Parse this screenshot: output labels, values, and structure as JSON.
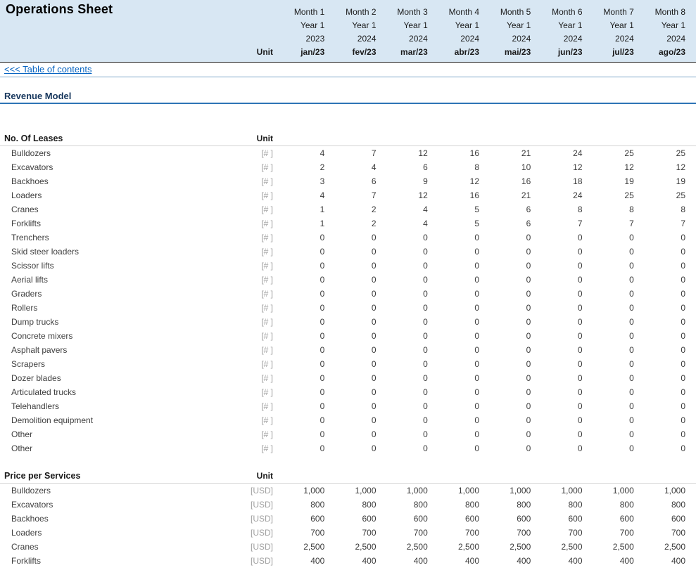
{
  "header": {
    "title": "Operations Sheet",
    "unit_label": "Unit",
    "columns": [
      {
        "month": "Month 1",
        "year": "Year 1",
        "cal_year": "2023",
        "date": "jan/23"
      },
      {
        "month": "Month 2",
        "year": "Year 1",
        "cal_year": "2024",
        "date": "fev/23"
      },
      {
        "month": "Month 3",
        "year": "Year 1",
        "cal_year": "2024",
        "date": "mar/23"
      },
      {
        "month": "Month 4",
        "year": "Year 1",
        "cal_year": "2024",
        "date": "abr/23"
      },
      {
        "month": "Month 5",
        "year": "Year 1",
        "cal_year": "2024",
        "date": "mai/23"
      },
      {
        "month": "Month 6",
        "year": "Year 1",
        "cal_year": "2024",
        "date": "jun/23"
      },
      {
        "month": "Month 7",
        "year": "Year 1",
        "cal_year": "2024",
        "date": "jul/23"
      },
      {
        "month": "Month 8",
        "year": "Year 1",
        "cal_year": "2024",
        "date": "ago/23"
      }
    ]
  },
  "toc_link": "<<< Table of contents",
  "revenue_section_title": "Revenue Model",
  "tables": [
    {
      "title": "No. Of Leases",
      "unit_header": "Unit",
      "rows": [
        {
          "label": "Bulldozers",
          "unit": "[# ]",
          "values": [
            "4",
            "7",
            "12",
            "16",
            "21",
            "24",
            "25",
            "25"
          ]
        },
        {
          "label": "Excavators",
          "unit": "[# ]",
          "values": [
            "2",
            "4",
            "6",
            "8",
            "10",
            "12",
            "12",
            "12"
          ]
        },
        {
          "label": "Backhoes",
          "unit": "[# ]",
          "values": [
            "3",
            "6",
            "9",
            "12",
            "16",
            "18",
            "19",
            "19"
          ]
        },
        {
          "label": "Loaders",
          "unit": "[# ]",
          "values": [
            "4",
            "7",
            "12",
            "16",
            "21",
            "24",
            "25",
            "25"
          ]
        },
        {
          "label": "Cranes",
          "unit": "[# ]",
          "values": [
            "1",
            "2",
            "4",
            "5",
            "6",
            "8",
            "8",
            "8"
          ]
        },
        {
          "label": "Forklifts",
          "unit": "[# ]",
          "values": [
            "1",
            "2",
            "4",
            "5",
            "6",
            "7",
            "7",
            "7"
          ]
        },
        {
          "label": "Trenchers",
          "unit": "[# ]",
          "values": [
            "0",
            "0",
            "0",
            "0",
            "0",
            "0",
            "0",
            "0"
          ]
        },
        {
          "label": "Skid steer loaders",
          "unit": "[# ]",
          "values": [
            "0",
            "0",
            "0",
            "0",
            "0",
            "0",
            "0",
            "0"
          ]
        },
        {
          "label": "Scissor lifts",
          "unit": "[# ]",
          "values": [
            "0",
            "0",
            "0",
            "0",
            "0",
            "0",
            "0",
            "0"
          ]
        },
        {
          "label": "Aerial lifts",
          "unit": "[# ]",
          "values": [
            "0",
            "0",
            "0",
            "0",
            "0",
            "0",
            "0",
            "0"
          ]
        },
        {
          "label": "Graders",
          "unit": "[# ]",
          "values": [
            "0",
            "0",
            "0",
            "0",
            "0",
            "0",
            "0",
            "0"
          ]
        },
        {
          "label": "Rollers",
          "unit": "[# ]",
          "values": [
            "0",
            "0",
            "0",
            "0",
            "0",
            "0",
            "0",
            "0"
          ]
        },
        {
          "label": "Dump trucks",
          "unit": "[# ]",
          "values": [
            "0",
            "0",
            "0",
            "0",
            "0",
            "0",
            "0",
            "0"
          ]
        },
        {
          "label": "Concrete mixers",
          "unit": "[# ]",
          "values": [
            "0",
            "0",
            "0",
            "0",
            "0",
            "0",
            "0",
            "0"
          ]
        },
        {
          "label": "Asphalt pavers",
          "unit": "[# ]",
          "values": [
            "0",
            "0",
            "0",
            "0",
            "0",
            "0",
            "0",
            "0"
          ]
        },
        {
          "label": "Scrapers",
          "unit": "[# ]",
          "values": [
            "0",
            "0",
            "0",
            "0",
            "0",
            "0",
            "0",
            "0"
          ]
        },
        {
          "label": "Dozer blades",
          "unit": "[# ]",
          "values": [
            "0",
            "0",
            "0",
            "0",
            "0",
            "0",
            "0",
            "0"
          ]
        },
        {
          "label": "Articulated trucks",
          "unit": "[# ]",
          "values": [
            "0",
            "0",
            "0",
            "0",
            "0",
            "0",
            "0",
            "0"
          ]
        },
        {
          "label": "Telehandlers",
          "unit": "[# ]",
          "values": [
            "0",
            "0",
            "0",
            "0",
            "0",
            "0",
            "0",
            "0"
          ]
        },
        {
          "label": "Demolition equipment",
          "unit": "[# ]",
          "values": [
            "0",
            "0",
            "0",
            "0",
            "0",
            "0",
            "0",
            "0"
          ]
        },
        {
          "label": "Other",
          "unit": "[# ]",
          "values": [
            "0",
            "0",
            "0",
            "0",
            "0",
            "0",
            "0",
            "0"
          ]
        },
        {
          "label": "Other",
          "unit": "[# ]",
          "values": [
            "0",
            "0",
            "0",
            "0",
            "0",
            "0",
            "0",
            "0"
          ]
        }
      ]
    },
    {
      "title": "Price per Services",
      "unit_header": "Unit",
      "rows": [
        {
          "label": "Bulldozers",
          "unit": "[USD]",
          "values": [
            "1,000",
            "1,000",
            "1,000",
            "1,000",
            "1,000",
            "1,000",
            "1,000",
            "1,000"
          ]
        },
        {
          "label": "Excavators",
          "unit": "[USD]",
          "values": [
            "800",
            "800",
            "800",
            "800",
            "800",
            "800",
            "800",
            "800"
          ]
        },
        {
          "label": "Backhoes",
          "unit": "[USD]",
          "values": [
            "600",
            "600",
            "600",
            "600",
            "600",
            "600",
            "600",
            "600"
          ]
        },
        {
          "label": "Loaders",
          "unit": "[USD]",
          "values": [
            "700",
            "700",
            "700",
            "700",
            "700",
            "700",
            "700",
            "700"
          ]
        },
        {
          "label": "Cranes",
          "unit": "[USD]",
          "values": [
            "2,500",
            "2,500",
            "2,500",
            "2,500",
            "2,500",
            "2,500",
            "2,500",
            "2,500"
          ]
        },
        {
          "label": "Forklifts",
          "unit": "[USD]",
          "values": [
            "400",
            "400",
            "400",
            "400",
            "400",
            "400",
            "400",
            "400"
          ]
        }
      ]
    }
  ]
}
